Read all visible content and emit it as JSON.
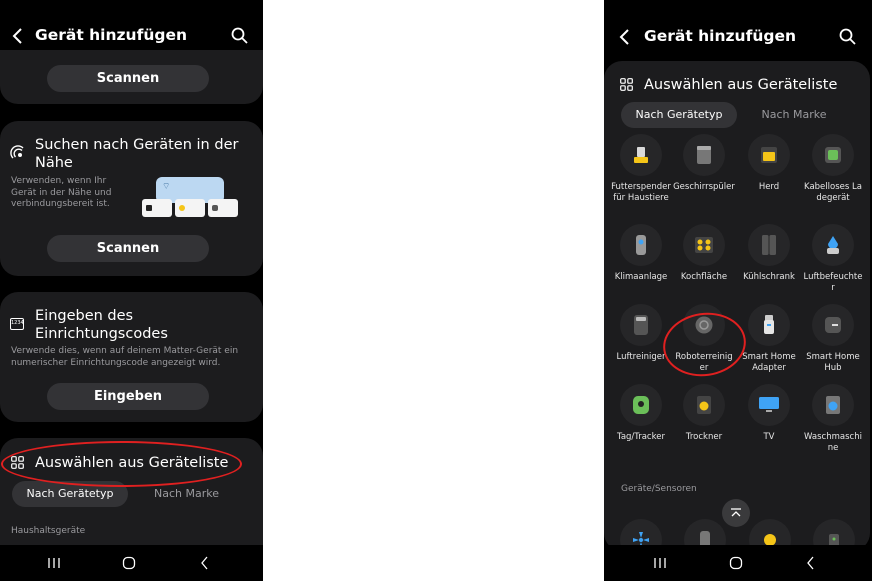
{
  "left": {
    "title": "Gerät hinzufügen",
    "top_scan_label": "Scannen",
    "nearby": {
      "title": "Suchen nach Geräten in der Nähe",
      "desc": "Verwenden, wenn Ihr Gerät in der Nähe und verbindungsbereit ist.",
      "scan_label": "Scannen"
    },
    "code": {
      "title": "Eingeben des Einrichtungscodes",
      "desc": "Verwende dies, wenn auf deinem Matter-Gerät ein numerischer Einrichtungscode angezeigt wird.",
      "enter_label": "Eingeben",
      "icon_text": "1234"
    },
    "list": {
      "title": "Auswählen aus Geräteliste",
      "tab_type": "Nach Gerätetyp",
      "tab_brand": "Nach Marke",
      "section": "Haushaltsgeräte"
    }
  },
  "right": {
    "title": "Gerät hinzufügen",
    "list_title": "Auswählen aus Geräteliste",
    "tab_type": "Nach Gerätetyp",
    "tab_brand": "Nach Marke",
    "devices": [
      {
        "label": "Futterspender für Haustiere",
        "icon": "pet-feeder-icon"
      },
      {
        "label": "Geschirrspüler",
        "icon": "dishwasher-icon"
      },
      {
        "label": "Herd",
        "icon": "oven-icon"
      },
      {
        "label": "Kabelloses Ladegerät",
        "icon": "wireless-charger-icon"
      },
      {
        "label": "Klimaanlage",
        "icon": "air-conditioner-icon"
      },
      {
        "label": "Kochfläche",
        "icon": "cooktop-icon"
      },
      {
        "label": "Kühlschrank",
        "icon": "fridge-icon"
      },
      {
        "label": "Luftbefeuchter",
        "icon": "humidifier-icon"
      },
      {
        "label": "Luftreiniger",
        "icon": "air-purifier-icon"
      },
      {
        "label": "Roboterreiniger",
        "icon": "robot-vacuum-icon"
      },
      {
        "label": "Smart Home Adapter",
        "icon": "smart-home-adapter-icon"
      },
      {
        "label": "Smart Home Hub",
        "icon": "smart-home-hub-icon"
      },
      {
        "label": "Tag/Tracker",
        "icon": "tag-tracker-icon"
      },
      {
        "label": "Trockner",
        "icon": "dryer-icon"
      },
      {
        "label": "TV",
        "icon": "tv-icon"
      },
      {
        "label": "Waschmaschine",
        "icon": "washer-icon"
      }
    ],
    "sensors_section": "Geräte/Sensoren"
  },
  "colors": {
    "background": "#000000",
    "card": "#1c1c1e",
    "pill": "#333336",
    "muted_text": "#9a9a9e",
    "annotation": "#e02020",
    "icon_yellow": "#f5c518",
    "icon_green": "#6bbf59",
    "icon_blue": "#3fa3f5"
  }
}
